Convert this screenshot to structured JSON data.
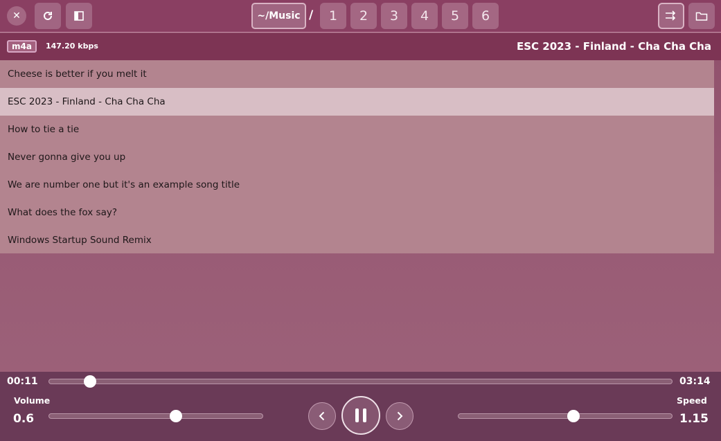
{
  "header": {
    "path_label": "~/Music",
    "separator": "/",
    "pages": [
      "1",
      "2",
      "3",
      "4",
      "5",
      "6"
    ]
  },
  "info": {
    "format": "m4a",
    "bitrate": "147.20 kbps",
    "now_playing": "ESC 2023 - Finland - Cha Cha Cha"
  },
  "playlist": {
    "active_index": 1,
    "items": [
      "Cheese is better if you melt it",
      "ESC 2023 - Finland - Cha Cha Cha",
      "How to tie a tie",
      "Never gonna give you up",
      "We are number one but it's an example song title",
      "What does the fox say?",
      "Windows Startup Sound Remix"
    ]
  },
  "player": {
    "elapsed": "00:11",
    "duration": "03:14",
    "progress_fraction": 0.0567,
    "volume_label": "Volume",
    "volume": "0.6",
    "speed_label": "Speed",
    "speed": "1.15"
  },
  "icons": {
    "close": "close-icon",
    "refresh": "refresh-icon",
    "sidebar": "sidebar-toggle-icon",
    "shuffle": "shuffle-icon",
    "folder": "folder-icon",
    "prev": "chevron-left-icon",
    "pause": "pause-icon",
    "next": "chevron-right-icon"
  }
}
